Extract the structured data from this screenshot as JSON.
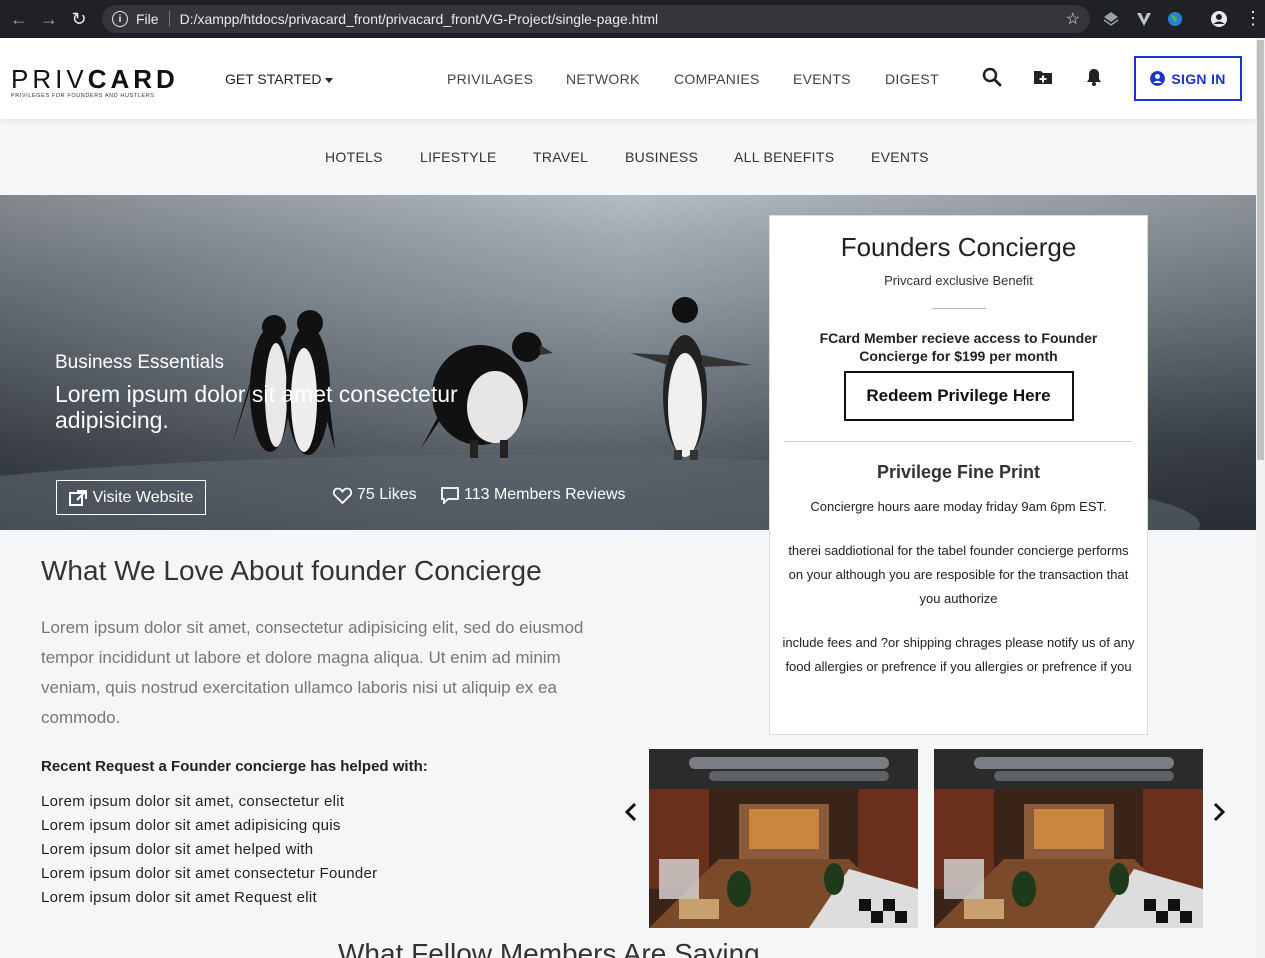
{
  "browser": {
    "file_label": "File",
    "url": "D:/xampp/htdocs/privacard_front/privacard_front/VG-Project/single-page.html"
  },
  "header": {
    "logo": {
      "light": "PRIV",
      "bold": "CARD",
      "tagline": "PRIVILEGES FOR FOUNDERS AND HUSTLERS"
    },
    "get_started": "GET STARTED",
    "nav": [
      "PRIVILAGES",
      "NETWORK",
      "COMPANIES",
      "EVENTS",
      "DIGEST"
    ],
    "sign_in": "SIGN IN"
  },
  "subnav": [
    "HOTELS",
    "LIFESTYLE",
    "TRAVEL",
    "BUSINESS",
    "ALL BENEFITS",
    "EVENTS"
  ],
  "hero": {
    "category": "Business Essentials",
    "title": "Lorem ipsum dolor sit amet consectetur adipisicing.",
    "visit_label": "Visite Website",
    "likes": "75 Likes",
    "reviews": "113 Members Reviews"
  },
  "card": {
    "title": "Founders Concierge",
    "subtitle": "Privcard exclusive Benefit",
    "description": "FCard Member recieve access to Founder Concierge for $199 per month",
    "redeem_label": "Redeem Privilege Here",
    "fine_print_title": "Privilege Fine Print",
    "fine_print": [
      "Conciergre hours aare moday friday 9am 6pm EST.",
      "therei saddiotional for the tabel founder concierge performs on your although you are resposible for the transaction that you authorize",
      "include fees and ?or shipping chrages please notify us of any food allergies or prefrence if you allergies or prefrence if you"
    ]
  },
  "main": {
    "section_title": "What We Love About founder Concierge",
    "paragraph": "Lorem ipsum dolor sit amet, consectetur adipisicing elit, sed do eiusmod tempor incididunt ut labore et dolore magna aliqua. Ut enim ad minim veniam, quis nostrud exercitation ullamco laboris nisi ut aliquip ex ea commodo.",
    "recent_title": "Recent Request a Founder concierge has helped with:",
    "recent_items": [
      "Lorem ipsum dolor sit amet, consectetur elit",
      "Lorem ipsum dolor sit amet adipisicing quis",
      "Lorem ipsum dolor sit amet helped with",
      "Lorem ipsum dolor sit amet consectetur Founder",
      "Lorem ipsum dolor sit amet Request elit"
    ],
    "next_section_title": "What Fellow Members Are Saying"
  },
  "icons": {
    "search": "search-icon",
    "folder_add": "folder-plus-icon",
    "bell": "bell-icon",
    "user": "user-circle-icon",
    "external": "external-link-icon",
    "heart": "heart-icon",
    "comment": "comment-icon",
    "prev": "chevron-left-icon",
    "next": "chevron-right-icon"
  },
  "colors": {
    "accent": "#1a35c9",
    "chrome": "#202124"
  }
}
